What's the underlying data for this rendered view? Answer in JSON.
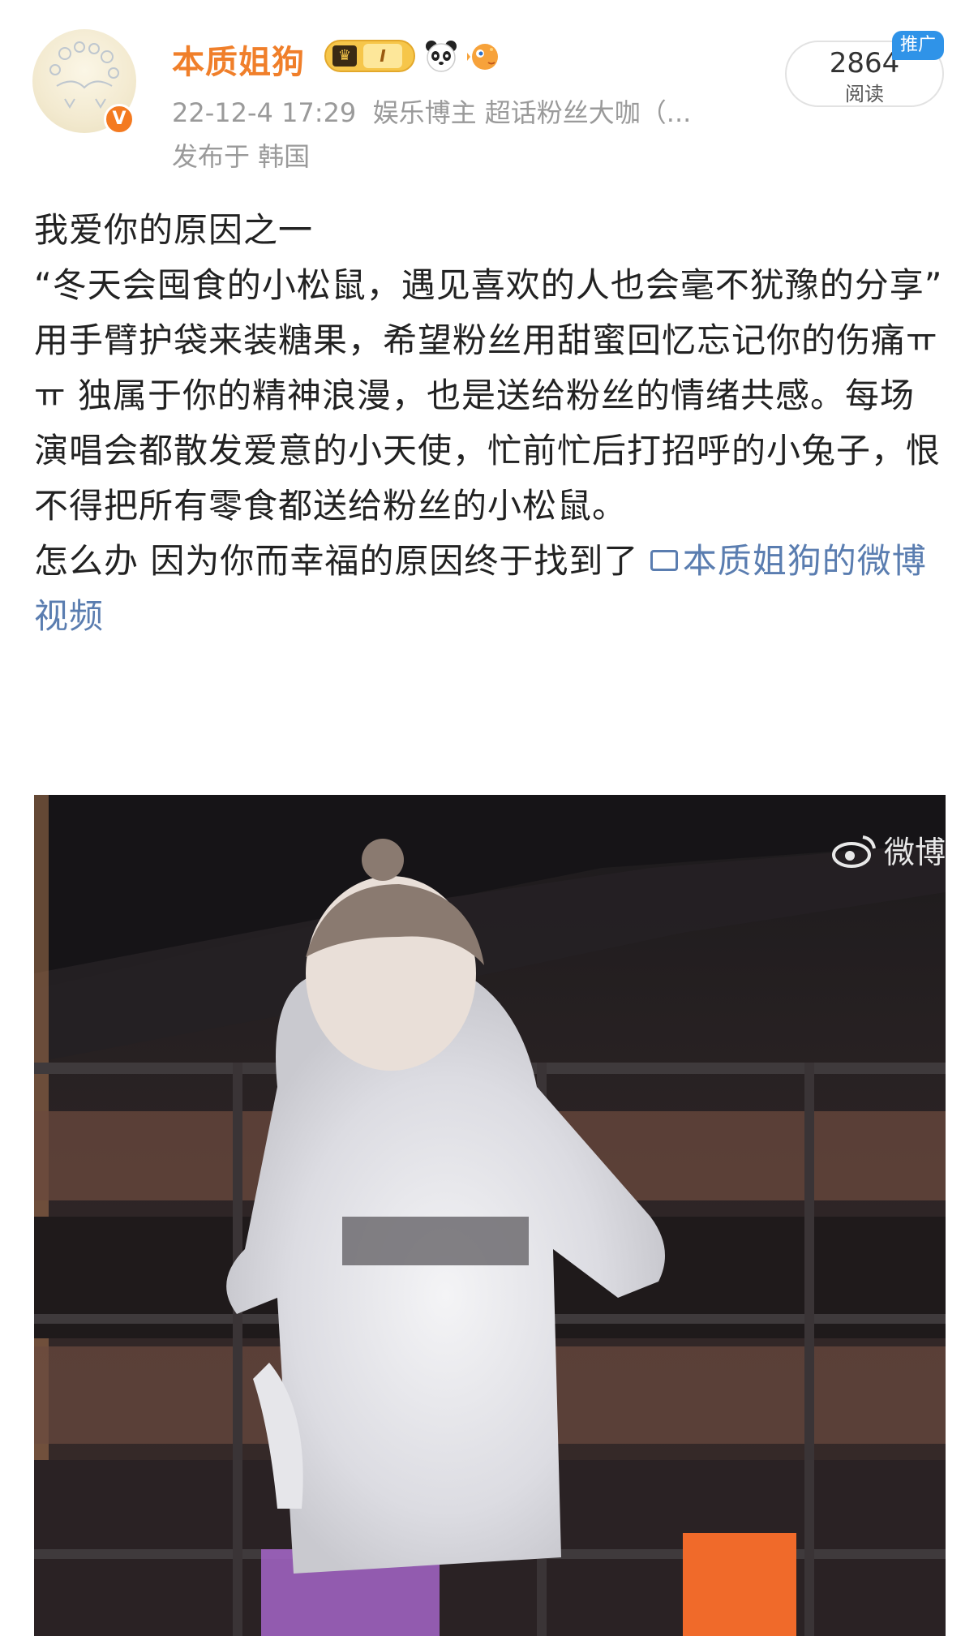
{
  "post": {
    "author": {
      "name": "本质姐狗",
      "verified_badge": "V",
      "vip_level": "I",
      "badge_icons": [
        "vip-crown-icon",
        "panda-icon",
        "puffer-fish-icon"
      ]
    },
    "meta": {
      "time": "22-12-4 17:29",
      "role": "娱乐博主 超话粉丝大咖（...",
      "location": "发布于 韩国"
    },
    "read": {
      "count": "2864",
      "label": "阅读",
      "promo": "推广"
    },
    "text": {
      "line1": "我爱你的原因之一",
      "quote": "“冬天会囤食的小松鼠，遇见喜欢的人也会毫不犹豫的分享”",
      "body": "用手臂护袋来装糖果，希望粉丝用甜蜜回忆忘记你的伤痛ㅠㅠ 独属于你的精神浪漫，也是送给粉丝的情绪共感。每场演唱会都散发爱意的小天使，忙前忙后打招呼的小兔子，恨不得把所有零食都送给粉丝的小松鼠。",
      "last_prefix": "怎么办 因为你而幸福的原因终于找到了 ",
      "video_link": "本质姐狗的微博视频"
    },
    "video": {
      "watermark": "微博"
    }
  },
  "colors": {
    "username": "#f07f2a",
    "meta": "#9a9a9a",
    "link": "#5a7db0",
    "promo": "#2f93e8",
    "verify": "#f47a20"
  }
}
